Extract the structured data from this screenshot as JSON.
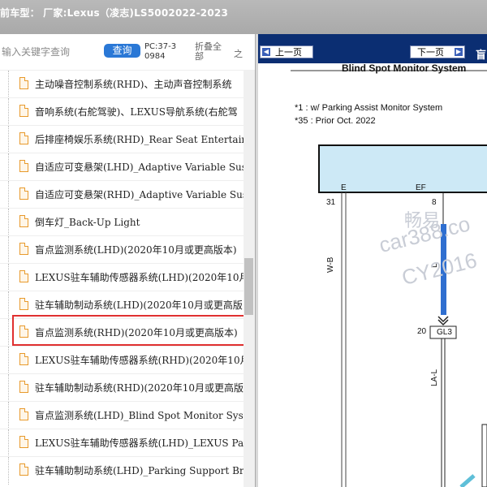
{
  "window": {
    "title": "前车型： 厂家:Lexus（凌志)LS5002022-2023"
  },
  "search": {
    "placeholder": "输入关键字查询",
    "button_label": "查询",
    "pc_code": "PC:37-30984",
    "collapse_label": "折叠全部",
    "expand_label_cut": "之"
  },
  "tree": {
    "items": [
      {
        "label": "主动噪音控制系统(RHD)、主动声音控制系统"
      },
      {
        "label": "音响系统(右舵驾驶)、LEXUS导航系统(右舵驾"
      },
      {
        "label": "后排座椅娱乐系统(RHD)_Rear Seat Entertainm"
      },
      {
        "label": "自适应可变悬架(LHD)_Adaptive Variable Susp"
      },
      {
        "label": "自适应可变悬架(RHD)_Adaptive Variable Susp"
      },
      {
        "label": "倒车灯_Back-Up Light"
      },
      {
        "label": "盲点监测系统(LHD)(2020年10月或更高版本)"
      },
      {
        "label": "LEXUS驻车辅助传感器系统(LHD)(2020年10月"
      },
      {
        "label": "驻车辅助制动系统(LHD)(2020年10月或更高版"
      },
      {
        "label": "盲点监测系统(RHD)(2020年10月或更高版本)"
      },
      {
        "label": "LEXUS驻车辅助传感器系统(RHD)(2020年10月"
      },
      {
        "label": "驻车辅助制动系统(RHD)(2020年10月或更高版"
      },
      {
        "label": "盲点监测系统(LHD)_Blind Spot Monitor Syste"
      },
      {
        "label": "LEXUS驻车辅助传感器系统(LHD)_LEXUS Pa"
      },
      {
        "label": "驻车辅助制动系统(LHD)_Parking Support Bra"
      }
    ],
    "selected_index": 9
  },
  "viewer": {
    "prev_label": "上一页",
    "next_label": "下一页",
    "title_cut": "盲",
    "page_heading": "Blind Spot Monitor System",
    "note_1": "*1 : w/ Parking Assist Monitor System",
    "note_35": "*35 : Prior Oct. 2022",
    "pin_e": "E",
    "pin_ef": "EF",
    "pin_31": "31",
    "pin_8": "8",
    "pin_20": "20",
    "wire_wb": "W-B",
    "wire_l": "L",
    "wire_lal": "LA-L",
    "connector_gl3": "GL3",
    "watermark_1": "畅易",
    "watermark_2": "car388.co",
    "watermark_3": "CY2016",
    "colors": {
      "wire_blue": "#2f6fd0",
      "box_fill": "#cde9f6",
      "toolbar": "#0b2e72",
      "highlight": "#e03030"
    }
  }
}
